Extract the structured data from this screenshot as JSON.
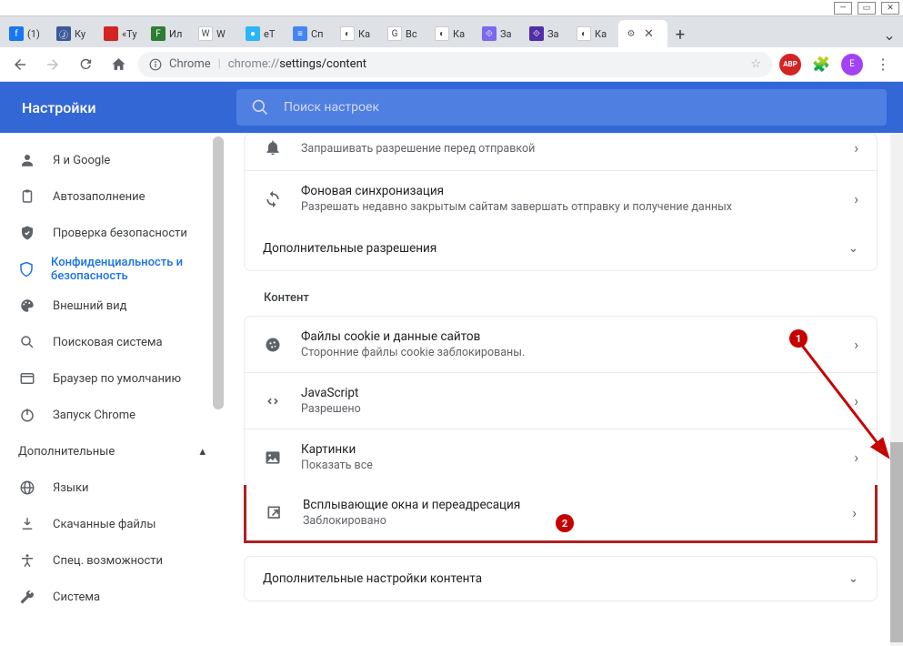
{
  "window_controls": {
    "min": "—",
    "max": "▭",
    "close": "✕"
  },
  "tabs": [
    {
      "label": "(1)",
      "color": "#1877f2",
      "glyph": "f"
    },
    {
      "label": "Ку",
      "color": "#3b5998",
      "glyph": "Ⓙ"
    },
    {
      "label": "«Ту",
      "color": "#d32323",
      "glyph": ""
    },
    {
      "label": "Ил",
      "color": "#2e7d32",
      "glyph": "F"
    },
    {
      "label": "W",
      "color": "#ffffff",
      "glyph": "W"
    },
    {
      "label": "eT",
      "color": "#29b6f6",
      "glyph": "●"
    },
    {
      "label": "Сп",
      "color": "#4285f4",
      "glyph": "≡"
    },
    {
      "label": "Ка",
      "color": "#ffffff",
      "glyph": "◐"
    },
    {
      "label": "Вс",
      "color": "#ffffff",
      "glyph": "G"
    },
    {
      "label": "Ка",
      "color": "#ffffff",
      "glyph": "◐"
    },
    {
      "label": "За",
      "color": "#7b68ee",
      "glyph": "⟐"
    },
    {
      "label": "За",
      "color": "#512da8",
      "glyph": "⟐"
    },
    {
      "label": "Ка",
      "color": "#ffffff",
      "glyph": "◐"
    }
  ],
  "active_tab": {
    "icon": "⚙",
    "close": "✕"
  },
  "toolbar": {
    "secure_label": "Chrome",
    "url_prefix": "chrome://",
    "url_rest": "settings/content"
  },
  "extensions": {
    "abp_label": "ABP",
    "puzzle": "🧩",
    "avatar_letter": "Е"
  },
  "header": {
    "title": "Настройки",
    "search_placeholder": "Поиск настроек"
  },
  "sidebar": {
    "items": [
      {
        "icon": "person",
        "label": "Я и Google"
      },
      {
        "icon": "clipboard",
        "label": "Автозаполнение"
      },
      {
        "icon": "shield-check",
        "label": "Проверка безопасности"
      },
      {
        "icon": "shield",
        "label": "Конфиденциальность и безопасность",
        "active": true
      },
      {
        "icon": "palette",
        "label": "Внешний вид"
      },
      {
        "icon": "search",
        "label": "Поисковая система"
      },
      {
        "icon": "window",
        "label": "Браузер по умолчанию"
      },
      {
        "icon": "power",
        "label": "Запуск Chrome"
      }
    ],
    "section": "Дополнительные",
    "items2": [
      {
        "icon": "globe",
        "label": "Языки"
      },
      {
        "icon": "download",
        "label": "Скачанные файлы"
      },
      {
        "icon": "accessibility",
        "label": "Спец. возможности"
      },
      {
        "icon": "wrench",
        "label": "Система"
      }
    ]
  },
  "content": {
    "row_notif_sub": "Запрашивать разрешение перед отправкой",
    "row_sync_title": "Фоновая синхронизация",
    "row_sync_sub": "Разрешать недавно закрытым сайтам завершать отправку и получение данных",
    "row_more_perm": "Дополнительные разрешения",
    "section_content": "Контент",
    "row_cookies_title": "Файлы cookie и данные сайтов",
    "row_cookies_sub": "Сторонние файлы cookie заблокированы.",
    "row_js_title": "JavaScript",
    "row_js_sub": "Разрешено",
    "row_img_title": "Картинки",
    "row_img_sub": "Показать все",
    "row_popup_title": "Всплывающие окна и переадресация",
    "row_popup_sub": "Заблокировано",
    "row_more_content": "Дополнительные настройки контента"
  },
  "annotations": {
    "badge1": "1",
    "badge2": "2"
  }
}
